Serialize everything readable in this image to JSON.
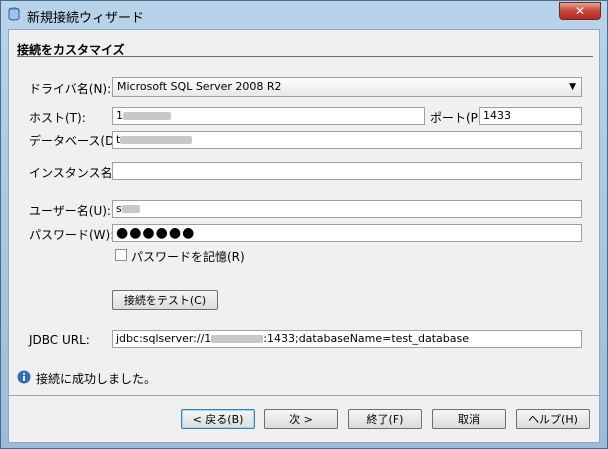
{
  "window": {
    "title": "新規接続ウィザード",
    "close_label": "✕"
  },
  "section": {
    "title": "接続をカスタマイズ"
  },
  "form": {
    "driver_label": "ドライバ名(N):",
    "driver_value": "Microsoft SQL Server 2008 R2",
    "host_label": "ホスト(T):",
    "host_value": "1",
    "port_label": "ポート(P):",
    "port_value": "1433",
    "database_label": "データベース(D):",
    "database_value": "t",
    "instance_label": "インスタンス名:",
    "instance_value": "",
    "user_label": "ユーザー名(U):",
    "user_value": "s",
    "password_label": "パスワード(W):",
    "password_value": "●●●●●●",
    "remember_label": "パスワードを記憶(R)",
    "remember_checked": false,
    "test_button": "接続をテスト(C)",
    "jdbc_label": "JDBC URL:",
    "jdbc_prefix": "jdbc:sqlserver://1",
    "jdbc_suffix": ":1433;databaseName=test_database"
  },
  "status": {
    "message": "接続に成功しました。"
  },
  "buttons": {
    "back": "< 戻る(B)",
    "next": "次 >",
    "finish": "終了(F)",
    "cancel": "取消",
    "help": "ヘルプ(H)"
  },
  "icons": {
    "window": "database-icon",
    "info": "info-icon"
  },
  "colors": {
    "accent": "#3c7fb1",
    "info": "#2f6db5",
    "close": "#c8453a"
  }
}
